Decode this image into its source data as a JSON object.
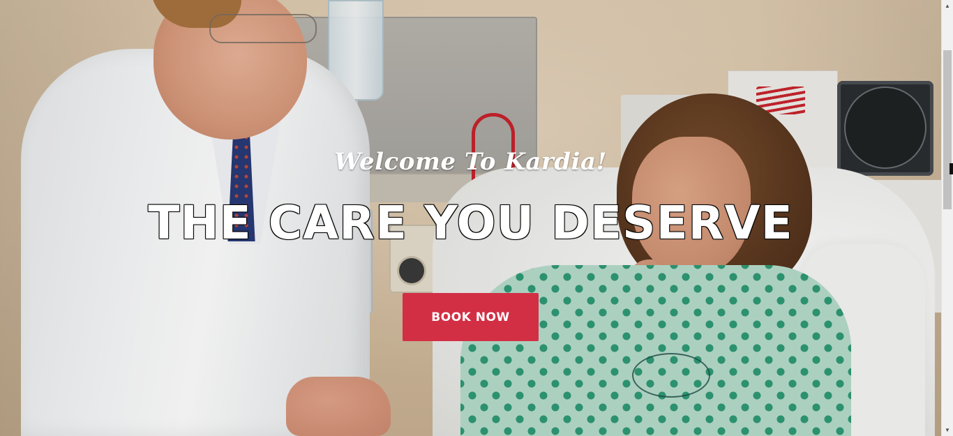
{
  "hero": {
    "welcome": "Welcome To Kardia!",
    "headline": "THE CARE YOU DESERVE",
    "cta_label": "BOOK NOW",
    "background_image": "doctor-and-patient-photo"
  },
  "colors": {
    "cta_background": "#d22f45",
    "text": "#ffffff",
    "scrollbar_track": "#f1f1f1",
    "scrollbar_thumb": "#c1c1c1"
  },
  "scrollbar": {
    "up_icon": "▲",
    "down_icon": "▼"
  }
}
